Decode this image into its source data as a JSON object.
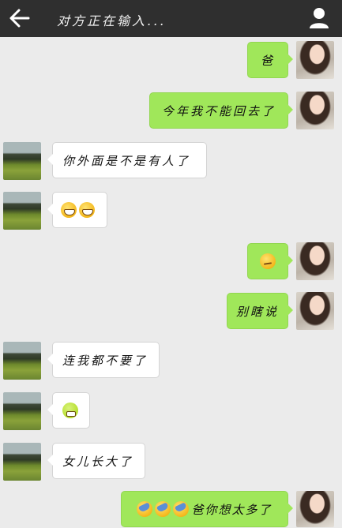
{
  "header": {
    "title": "对方正在输入...",
    "back_icon": "back-arrow-icon",
    "profile_icon": "user-icon"
  },
  "colors": {
    "topbar": "#2f2f2f",
    "background": "#ebebeb",
    "self_bubble": "#a0e75a",
    "other_bubble": "#ffffff"
  },
  "messages": [
    {
      "sender": "self",
      "text": "爸",
      "emojis": []
    },
    {
      "sender": "self",
      "text": "今年我不能回去了",
      "emojis": []
    },
    {
      "sender": "other",
      "text": "你外面是不是有人了",
      "emojis": []
    },
    {
      "sender": "other",
      "text": "",
      "emojis": [
        "grin",
        "grin"
      ]
    },
    {
      "sender": "self",
      "text": "",
      "emojis": [
        "smirk"
      ]
    },
    {
      "sender": "self",
      "text": "别瞎说",
      "emojis": []
    },
    {
      "sender": "other",
      "text": "连我都不要了",
      "emojis": []
    },
    {
      "sender": "other",
      "text": "",
      "emojis": [
        "cry"
      ]
    },
    {
      "sender": "other",
      "text": "女儿长大了",
      "emojis": []
    },
    {
      "sender": "self",
      "text": "爸你想太多了",
      "emojis": [
        "sweat",
        "sweat",
        "sweat"
      ]
    }
  ]
}
